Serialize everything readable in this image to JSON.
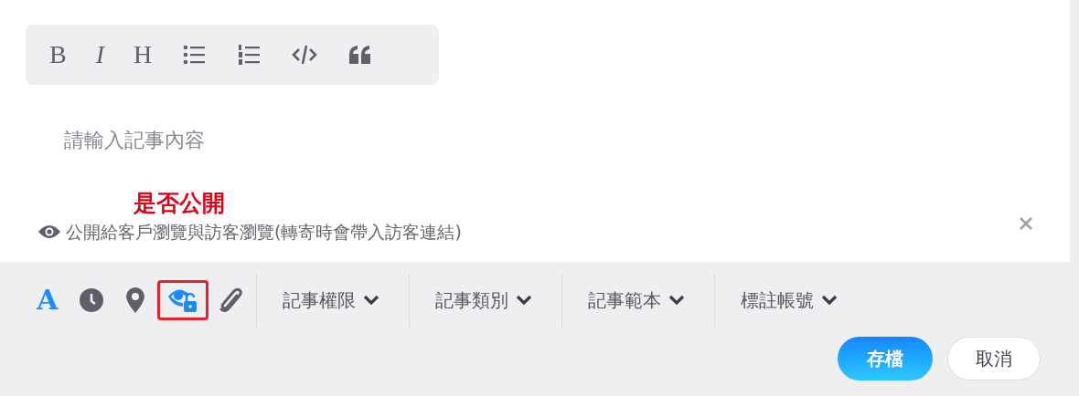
{
  "format_toolbar": [
    {
      "kind": "text",
      "label": "B"
    },
    {
      "kind": "text",
      "label": "I",
      "italic": true
    },
    {
      "kind": "text",
      "label": "H"
    },
    {
      "kind": "bullet-list"
    },
    {
      "kind": "numbered-list"
    },
    {
      "kind": "code"
    },
    {
      "kind": "quote"
    }
  ],
  "editor": {
    "placeholder": "請輸入記事內容"
  },
  "annotation": {
    "label": "是否公開"
  },
  "visibility_note": {
    "text": "公開給客戶瀏覽與訪客瀏覽(轉寄時會帶入訪客連結)"
  },
  "tools": [
    {
      "kind": "font",
      "label": "A",
      "active": true,
      "highlighted": false
    },
    {
      "kind": "clock",
      "active": false,
      "highlighted": false
    },
    {
      "kind": "pin",
      "active": false,
      "highlighted": false
    },
    {
      "kind": "visibility",
      "active": true,
      "highlighted": true
    },
    {
      "kind": "attach",
      "active": false,
      "highlighted": false
    }
  ],
  "dropdowns": [
    "記事權限",
    "記事類別",
    "記事範本",
    "標註帳號"
  ],
  "buttons": {
    "save": "存檔",
    "cancel": "取消"
  }
}
